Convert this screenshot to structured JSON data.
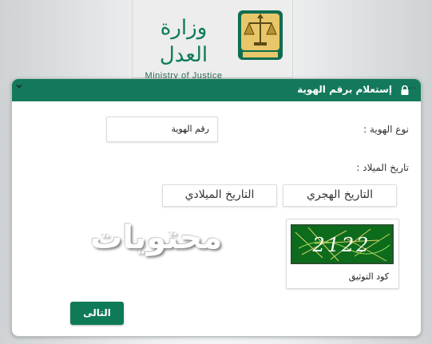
{
  "header": {
    "logo_ar": "وزارة العدل",
    "logo_en": "Ministry of Justice",
    "brand_color": "#14795c"
  },
  "panel": {
    "title": "إستعلام برقم الهوية",
    "title_icon": "lock-icon"
  },
  "form": {
    "id_type_label": "نوع الهوية :",
    "id_type_selected": "...",
    "id_number_placeholder": "رقم الهوية",
    "birth_date_label": "تاريخ الميلاد :",
    "hijri_button": "التاريخ الهجري",
    "gregorian_button": "التاريخ الميلادي",
    "captcha_value": "2122",
    "captcha_label": "كود التوثيق",
    "next_button": "التالى"
  },
  "watermark": {
    "text": "محتويات"
  }
}
